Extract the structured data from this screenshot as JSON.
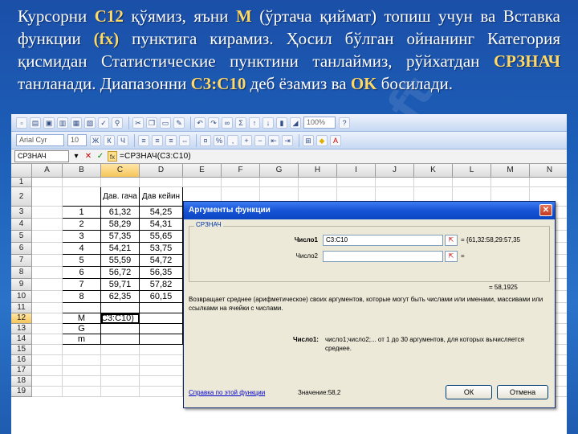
{
  "slide": {
    "p1": "Курсорни ",
    "c12": "C12",
    "p2": " қўямиз, яъни ",
    "m": "M",
    "p3": " (ўртача қиймат) топиш учун ва Вставка функции ",
    "fx": "(fx)",
    "p4": " пунктига кирамиз. Ҳосил бўлган ойнанинг Категория қисмидан Статистические пунктини танлаймиз, рўйхатдан ",
    "srznach": "СРЗНАЧ",
    "p5": " танланади. Диапазонни ",
    "range": "C3:C10",
    "p6": " деб ёзамиз ва ",
    "ok": "OK",
    "p7": " босилади."
  },
  "watermark": "soft",
  "excel": {
    "font_name": "Arial Cyr",
    "font_size": "10",
    "zoom": "100%",
    "namebox": "СРЗНАЧ",
    "formula": "=СРЗНАЧ(C3:C10)",
    "columns": [
      "A",
      "B",
      "C",
      "D",
      "E",
      "F",
      "G",
      "H",
      "I",
      "J",
      "K",
      "L",
      "M",
      "N"
    ],
    "rows": [
      "1",
      "2",
      "3",
      "4",
      "5",
      "6",
      "7",
      "8",
      "9",
      "10",
      "11",
      "12",
      "13",
      "14",
      "15",
      "16",
      "17",
      "18",
      "19"
    ],
    "header_c": "Дав. гача",
    "header_d": "Дав кейин",
    "table": [
      {
        "b": "1",
        "c": "61,32",
        "d": "54,25"
      },
      {
        "b": "2",
        "c": "58,29",
        "d": "54,31"
      },
      {
        "b": "3",
        "c": "57,35",
        "d": "55,65"
      },
      {
        "b": "4",
        "c": "54,21",
        "d": "53,75"
      },
      {
        "b": "5",
        "c": "55,59",
        "d": "54,72"
      },
      {
        "b": "6",
        "c": "56,72",
        "d": "56,35"
      },
      {
        "b": "7",
        "c": "59,71",
        "d": "57,82"
      },
      {
        "b": "8",
        "c": "62,35",
        "d": "60,15"
      }
    ],
    "stats": [
      {
        "b": "M",
        "c": "C3:C10)"
      },
      {
        "b": "G",
        "c": ""
      },
      {
        "b": "m",
        "c": ""
      }
    ]
  },
  "dialog": {
    "title": "Аргументы функции",
    "group": "СРЗНАЧ",
    "arg1_label": "Число1",
    "arg1_value": "C3:C10",
    "arg1_result": "= {61,32:58,29:57,35",
    "arg2_label": "Число2",
    "arg2_result": "=",
    "total": "= 58,1925",
    "description": "Возвращает среднее (арифметическое) своих аргументов, которые могут быть числами или именами, массивами или ссылками на ячейки с числами.",
    "param_label": "Число1:",
    "param_desc": "число1;число2;... от 1 до 30 аргументов, для которых вычисляется среднее.",
    "help_link": "Справка по этой функции",
    "value_label": "Значение:58,2",
    "ok_label": "ОК",
    "cancel_label": "Отмена",
    "close_glyph": "✕",
    "collapse_glyph": "⇱"
  }
}
